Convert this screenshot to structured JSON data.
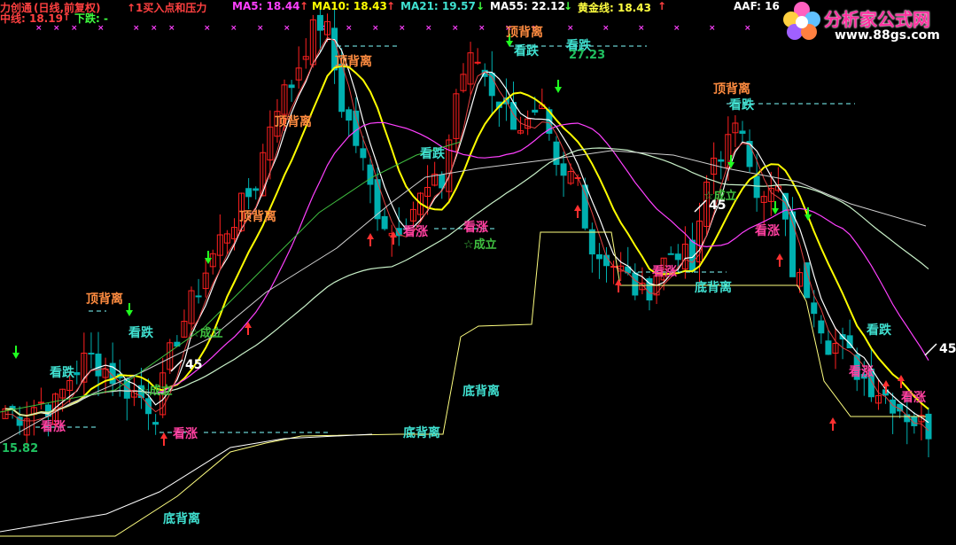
{
  "header": {
    "title": "力创通",
    "period": "(日线,前复权)",
    "buy_label": "↑1买入点和压力",
    "ma5": "MA5: 18.44",
    "ma5_arrow": "↑",
    "ma10": "MA10: 18.43",
    "ma10_arrow": "↑",
    "ma21": "MA21: 19.57",
    "ma21_arrow": "↓",
    "ma55": "MA55: 22.12",
    "ma55_arrow": "↓",
    "gold": "黄金线: 18.43",
    "gold_arrow": "↑",
    "aaf": "AAF: 16",
    "mid_line": "中线: 18.19",
    "mid_arrow": "↑",
    "down": "下跌: -"
  },
  "logo": {
    "text": "分析家公式网",
    "url": "www.88gs.com"
  },
  "colors": {
    "up": "#ff2020",
    "down": "#00b0b0",
    "ma5": "#ffffff",
    "ma10": "#ffff00",
    "ma21": "#ff40ff",
    "ma55": "#00ff00",
    "gold": "#ffff40",
    "top_div": "#ff8c40",
    "look_down": "#40e0d0",
    "look_up": "#ff40a0",
    "bottom_div": "#40e0d0"
  },
  "chart_data": {
    "type": "candlestick",
    "title": "力创通",
    "candles_close_trend": [
      16.2,
      16.0,
      16.4,
      16.3,
      17.3,
      17.8,
      17.4,
      16.9,
      16.6,
      16.1,
      18.2,
      19.3,
      20.5,
      21.6,
      22.3,
      23.2,
      25.5,
      26.1,
      27.5,
      28.2,
      25.6,
      24.2,
      22.5,
      21.6,
      22.2,
      22.8,
      23.1,
      26.3,
      27.0,
      26.0,
      25.2,
      24.8,
      25.1,
      23.0,
      23.5,
      21.0,
      20.8,
      20.2,
      19.6,
      20.6,
      21.2,
      20.4,
      23.8,
      24.3,
      24.9,
      22.4,
      23.0,
      20.2,
      19.8,
      18.3,
      18.0,
      17.2,
      16.8,
      16.4,
      15.9,
      15.6
    ],
    "price_labels": [
      {
        "text": "27.23"
      },
      {
        "text": "15.82"
      }
    ],
    "annotations": [
      {
        "text": "顶背离",
        "type": "top_divergence"
      },
      {
        "text": "顶背离",
        "type": "top_divergence"
      },
      {
        "text": "顶背离",
        "type": "top_divergence"
      },
      {
        "text": "顶背离",
        "type": "top_divergence"
      },
      {
        "text": "顶背离",
        "type": "top_divergence"
      },
      {
        "text": "顶背离",
        "type": "top_divergence"
      },
      {
        "text": "看跌",
        "type": "look_down"
      },
      {
        "text": "看跌",
        "type": "look_down"
      },
      {
        "text": "看跌",
        "type": "look_down"
      },
      {
        "text": "看跌",
        "type": "look_down"
      },
      {
        "text": "看跌",
        "type": "look_down"
      },
      {
        "text": "看跌",
        "type": "look_down"
      },
      {
        "text": "看跌",
        "type": "look_down"
      },
      {
        "text": "看涨",
        "type": "look_up"
      },
      {
        "text": "看涨",
        "type": "look_up"
      },
      {
        "text": "看涨",
        "type": "look_up"
      },
      {
        "text": "看涨",
        "type": "look_up"
      },
      {
        "text": "看涨",
        "type": "look_up"
      },
      {
        "text": "看涨",
        "type": "look_up"
      },
      {
        "text": "看涨",
        "type": "look_up"
      },
      {
        "text": "看涨",
        "type": "look_up"
      },
      {
        "text": "底背离",
        "type": "bottom_divergence"
      },
      {
        "text": "底背离",
        "type": "bottom_divergence"
      },
      {
        "text": "底背离",
        "type": "bottom_divergence"
      },
      {
        "text": "底背离",
        "type": "bottom_divergence"
      },
      {
        "text": "☆成立",
        "type": "confirm"
      },
      {
        "text": "☆成立",
        "type": "confirm"
      },
      {
        "text": "☆成立",
        "type": "confirm"
      },
      {
        "text": "☆成立",
        "type": "confirm"
      },
      {
        "text": "45",
        "type": "angle"
      },
      {
        "text": "45",
        "type": "angle"
      },
      {
        "text": "45",
        "type": "angle"
      }
    ]
  }
}
